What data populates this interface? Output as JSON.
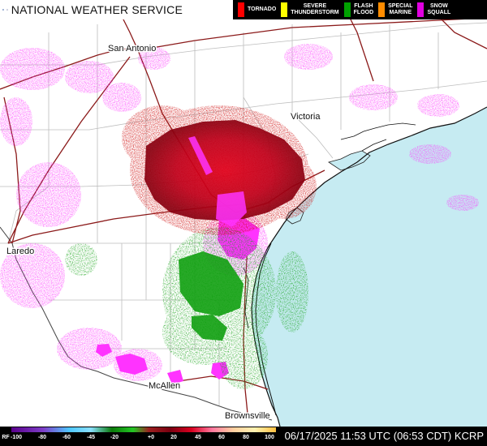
{
  "header": {
    "agency": "NATIONAL WEATHER SERVICE",
    "logo_icons": [
      "noaa-logo-icon",
      "nws-logo-icon"
    ]
  },
  "warning_legend": [
    {
      "label": "TORNADO",
      "color": "#ff0000"
    },
    {
      "label": "SEVERE\nTHUNDERSTORM",
      "color": "#ffff00"
    },
    {
      "label": "FLASH\nFLOOD",
      "color": "#00a000"
    },
    {
      "label": "SPECIAL\nMARINE",
      "color": "#ff8c00"
    },
    {
      "label": "SNOW\nSQUALL",
      "color": "#e000e0"
    }
  ],
  "map": {
    "cities": [
      "San Antonio",
      "Victoria",
      "Laredo",
      "McAllen",
      "Brownsville"
    ],
    "colors": {
      "land": "#ffffff",
      "water": "#c6ebf2",
      "county_lines": "#bbbbbb",
      "highways": "#8b1a1a",
      "heavy_rain": "#cc0000",
      "moderate_rain": "#11a011",
      "mixed_precip": "#ff33ff"
    }
  },
  "footer": {
    "scale_label": "RF",
    "scale_ticks": [
      "-100",
      "-80",
      "-60",
      "-45",
      "-20",
      "+0",
      "20",
      "45",
      "60",
      "80",
      "100"
    ],
    "timestamp": "06/17/2025 11:53 UTC (06:53 CDT) KCRP"
  }
}
